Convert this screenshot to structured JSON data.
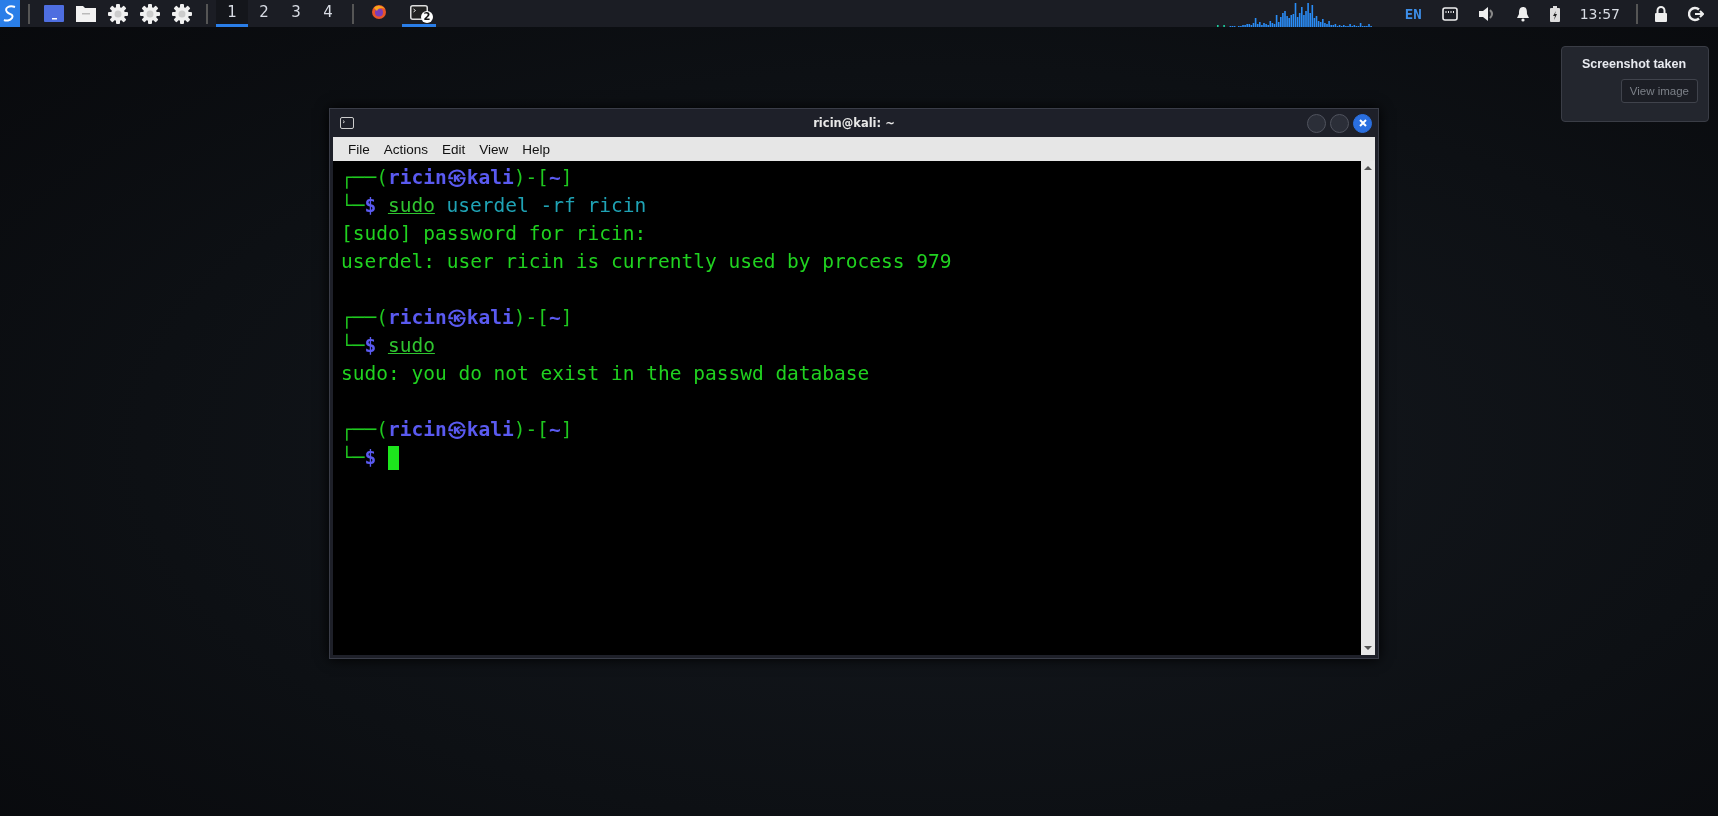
{
  "panel": {
    "workspaces": [
      {
        "label": "1",
        "selected": true
      },
      {
        "label": "2",
        "selected": false
      },
      {
        "label": "3",
        "selected": false
      },
      {
        "label": "4",
        "selected": false
      }
    ],
    "tasks": [
      {
        "kind": "browser",
        "selected": false
      },
      {
        "kind": "terminal",
        "selected": true,
        "badge": "2"
      }
    ],
    "keyboard_layout": "EN",
    "clock": "13:57"
  },
  "notification": {
    "title": "Screenshot taken",
    "button": "View image"
  },
  "window": {
    "title": "ricin@kali: ~",
    "menu": [
      "File",
      "Actions",
      "Edit",
      "View",
      "Help"
    ],
    "lines": [
      {
        "kind": "text",
        "parts": [
          {
            "kind": "frame",
            "text": "┌──("
          },
          {
            "kind": "user",
            "text": "ricin㉿kali"
          },
          {
            "kind": "frame",
            "text": ")-["
          },
          {
            "kind": "path",
            "text": "~"
          },
          {
            "kind": "frame",
            "text": "]"
          }
        ]
      },
      {
        "kind": "text",
        "parts": [
          {
            "kind": "frame",
            "text": "└─"
          },
          {
            "kind": "dollar",
            "text": "$"
          },
          {
            "kind": "cmd",
            "text": "sudo"
          },
          {
            "kind": "arg",
            "text": "userdel -rf ricin"
          }
        ]
      },
      {
        "kind": "text",
        "parts": [
          {
            "kind": "out",
            "text": "[sudo] password for ricin:"
          }
        ]
      },
      {
        "kind": "text",
        "parts": [
          {
            "kind": "out",
            "text": "userdel: user ricin is currently used by process 979"
          }
        ]
      },
      {
        "kind": "blank"
      },
      {
        "kind": "text",
        "parts": [
          {
            "kind": "frame",
            "text": "┌──("
          },
          {
            "kind": "user",
            "text": "ricin㉿kali"
          },
          {
            "kind": "frame",
            "text": ")-["
          },
          {
            "kind": "path",
            "text": "~"
          },
          {
            "kind": "frame",
            "text": "]"
          }
        ]
      },
      {
        "kind": "text",
        "parts": [
          {
            "kind": "frame",
            "text": "└─"
          },
          {
            "kind": "dollar",
            "text": "$"
          },
          {
            "kind": "cmd",
            "text": "sudo"
          }
        ]
      },
      {
        "kind": "text",
        "parts": [
          {
            "kind": "out",
            "text": "sudo: you do not exist in the passwd database"
          }
        ]
      },
      {
        "kind": "blank"
      },
      {
        "kind": "text",
        "parts": [
          {
            "kind": "frame",
            "text": "┌──("
          },
          {
            "kind": "user",
            "text": "ricin㉿kali"
          },
          {
            "kind": "frame",
            "text": ")-["
          },
          {
            "kind": "path",
            "text": "~"
          },
          {
            "kind": "frame",
            "text": "]"
          }
        ]
      },
      {
        "kind": "text",
        "parts": [
          {
            "kind": "frame",
            "text": "└─"
          },
          {
            "kind": "dollar",
            "text": "$"
          },
          {
            "kind": "cursor"
          }
        ]
      }
    ]
  }
}
